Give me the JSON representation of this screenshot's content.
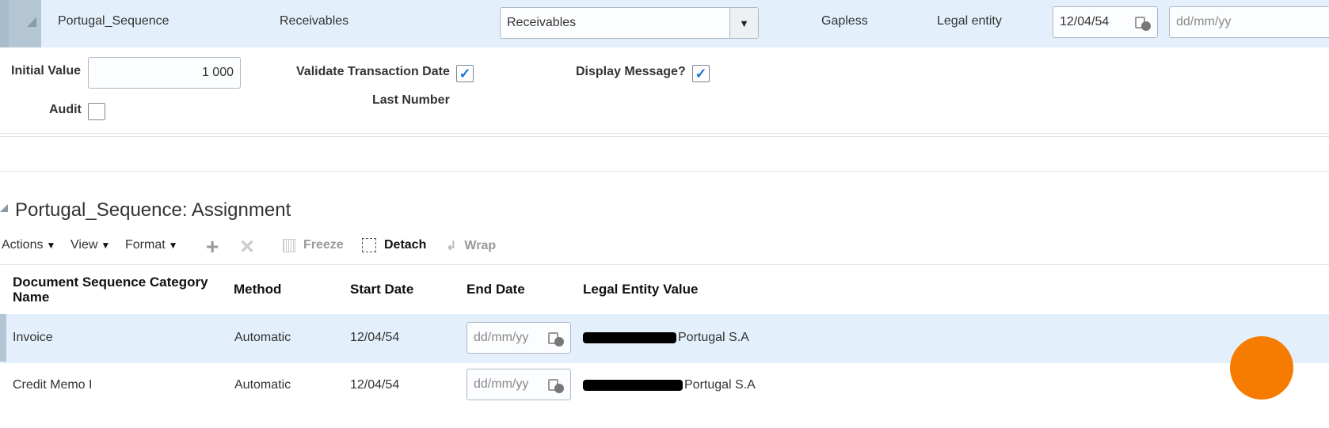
{
  "header_row": {
    "name": "Portugal_Sequence",
    "application": "Receivables",
    "module_select": "Receivables",
    "type": "Gapless",
    "determinant_type": "Legal entity",
    "start_date": "12/04/54",
    "end_date_placeholder": "dd/mm/yy"
  },
  "details": {
    "initial_value_label": "Initial Value",
    "initial_value": "1 000",
    "validate_label": "Validate Transaction Date",
    "validate_checked": true,
    "display_message_label": "Display Message?",
    "display_message_checked": true,
    "audit_label": "Audit",
    "audit_checked": false,
    "last_number_label": "Last Number"
  },
  "assignment": {
    "title": "Portugal_Sequence: Assignment",
    "toolbar": {
      "actions": "Actions",
      "view": "View",
      "format": "Format",
      "freeze": "Freeze",
      "detach": "Detach",
      "wrap": "Wrap"
    },
    "columns": [
      "Document Sequence Category Name",
      "Method",
      "Start Date",
      "End Date",
      "Legal Entity Value"
    ],
    "rows": [
      {
        "category": "Invoice",
        "method": "Automatic",
        "start_date": "12/04/54",
        "end_date_placeholder": "dd/mm/yy",
        "legal_entity": "Portugal S.A"
      },
      {
        "category": "Credit Memo I",
        "method": "Automatic",
        "start_date": "12/04/54",
        "end_date_placeholder": "dd/mm/yy",
        "legal_entity": "Portugal S.A"
      }
    ]
  },
  "colors": {
    "selected_row": "#e3f0fc",
    "accent_check": "#1a74d4",
    "orange": "#f57c00"
  }
}
